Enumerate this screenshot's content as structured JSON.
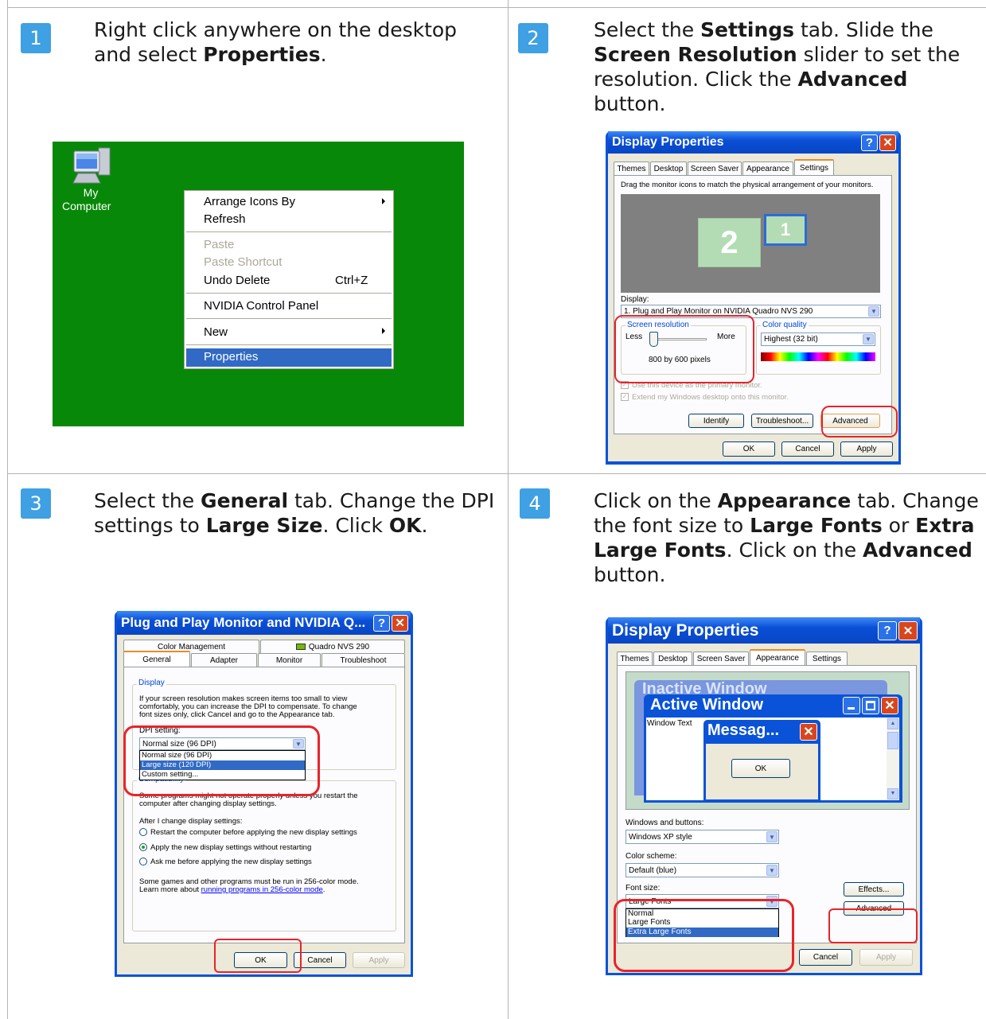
{
  "steps": [
    {
      "number": "1",
      "text_parts": [
        "Right click anywhere on the desktop and select ",
        "Properties",
        "."
      ]
    },
    {
      "number": "2",
      "text_parts": [
        "Select the ",
        "Settings",
        " tab.  Slide the ",
        "Screen Resolution",
        " slider to set the resolution.  Click the ",
        "Advanced",
        " button."
      ]
    },
    {
      "number": "3",
      "text_parts": [
        "Select the ",
        "General",
        " tab.  Change the DPI settings to ",
        "Large Size",
        ".  Click ",
        "OK",
        "."
      ]
    },
    {
      "number": "4",
      "text_parts": [
        "Click on the ",
        "Appearance",
        " tab.  Change the font size to ",
        "Large Fonts",
        " or ",
        "Extra Large Fonts",
        ".  Click on the ",
        "Advanced",
        " button."
      ]
    }
  ],
  "desktop": {
    "background": "#088808",
    "icon_label_line1": "My",
    "icon_label_line2": "Computer",
    "menu": {
      "arrange": "Arrange Icons By",
      "refresh": "Refresh",
      "paste": "Paste",
      "paste_shortcut": "Paste Shortcut",
      "undo": "Undo Delete",
      "undo_shortcut": "Ctrl+Z",
      "nvidia": "NVIDIA Control Panel",
      "new": "New",
      "properties": "Properties"
    }
  },
  "settings_dialog": {
    "title": "Display Properties",
    "tabs": [
      "Themes",
      "Desktop",
      "Screen Saver",
      "Appearance",
      "Settings"
    ],
    "instructions": "Drag the monitor icons to match the physical arrangement of your monitors.",
    "monitor_2": "2",
    "monitor_1": "1",
    "display_label": "Display:",
    "display_value": "1. Plug and Play Monitor on NVIDIA Quadro NVS 290",
    "resolution_group": "Screen resolution",
    "less": "Less",
    "more": "More",
    "resolution_value": "800 by 600 pixels",
    "slider_position": 0,
    "color_group": "Color quality",
    "color_value": "Highest (32 bit)",
    "primary_check": "Use this device as the primary monitor.",
    "extend_check": "Extend my Windows desktop onto this monitor.",
    "identify": "Identify",
    "troubleshoot": "Troubleshoot...",
    "advanced": "Advanced",
    "ok": "OK",
    "cancel": "Cancel",
    "apply": "Apply"
  },
  "monitor_dialog": {
    "title": "Plug and Play Monitor and NVIDIA Q...",
    "tabs_row1": [
      "Color Management",
      "Quadro NVS 290"
    ],
    "tabs_row2": [
      "General",
      "Adapter",
      "Monitor",
      "Troubleshoot"
    ],
    "display_group": "Display",
    "display_text_1": "If your screen resolution makes screen items too small to view",
    "display_text_2": "comfortably, you can increase the DPI to compensate.  To change",
    "display_text_3": "font sizes only, click Cancel and go to the Appearance tab.",
    "dpi_label": "DPI setting:",
    "dpi_value": "Normal size (96 DPI)",
    "dpi_options": [
      "Normal size (96 DPI)",
      "Large size (120 DPI)",
      "Custom setting..."
    ],
    "compat_group": "Compatibility",
    "compat_text_1": "Some programs might not operate properly unless you restart the",
    "compat_text_2": "computer after changing display settings.",
    "after_label": "After I change display settings:",
    "radio_restart": "Restart the computer before applying the new display settings",
    "radio_apply": "Apply the new display settings without restarting",
    "radio_ask": "Ask me before applying the new display settings",
    "games_text_1": "Some games and other programs must be run in 256-color mode.",
    "games_text_2": "Learn more about ",
    "games_link": "running programs in 256-color mode",
    "games_text_3": ".",
    "ok": "OK",
    "cancel": "Cancel",
    "apply": "Apply"
  },
  "appearance_dialog": {
    "title": "Display Properties",
    "tabs": [
      "Themes",
      "Desktop",
      "Screen Saver",
      "Appearance",
      "Settings"
    ],
    "inactive_title": "Inactive Window",
    "active_title": "Active Window",
    "window_text": "Window Text",
    "message_title": "Messag...",
    "message_ok": "OK",
    "windows_buttons_label": "Windows and buttons:",
    "windows_buttons_value": "Windows XP style",
    "color_scheme_label": "Color scheme:",
    "color_scheme_value": "Default (blue)",
    "font_size_label": "Font size:",
    "font_size_value": "Large Fonts",
    "font_options": [
      "Normal",
      "Large Fonts",
      "Extra Large Fonts"
    ],
    "effects": "Effects...",
    "advanced": "Advanced",
    "cancel": "Cancel",
    "apply": "Apply"
  }
}
